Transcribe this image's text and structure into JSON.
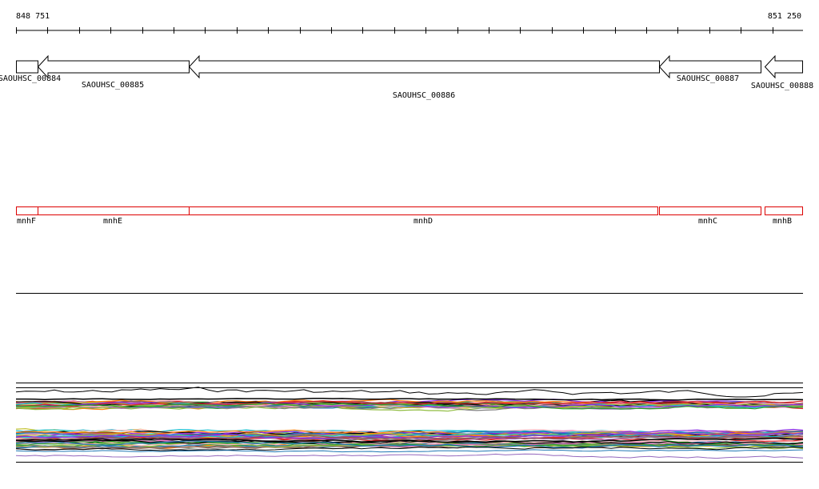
{
  "ruler": {
    "start_label": "848 751",
    "end_label": "851 250",
    "start": 848751,
    "end": 851250
  },
  "genes": [
    {
      "locus": "SAOUHSC_00884",
      "name": "mnhF",
      "strand": "+"
    },
    {
      "locus": "SAOUHSC_00885",
      "name": "mnhE",
      "strand": "-"
    },
    {
      "locus": "SAOUHSC_00886",
      "name": "mnhD",
      "strand": "-"
    },
    {
      "locus": "SAOUHSC_00887",
      "name": "mnhC",
      "strand": "-"
    },
    {
      "locus": "SAOUHSC_00888",
      "name": "mnhB",
      "strand": "-"
    }
  ],
  "colors": {
    "gene_outline": "#000000",
    "name_box": "#dd0000",
    "track_line": "#000000",
    "expression_palette": [
      "#d62728",
      "#2ca02c",
      "#1f77b4",
      "#ff7f0e",
      "#9467bd",
      "#8c564b",
      "#e377c2",
      "#7f7f7f",
      "#bcbd22",
      "#17becf",
      "#000000",
      "#8fbc3f",
      "#ffb6c1",
      "#8a2be2"
    ]
  }
}
